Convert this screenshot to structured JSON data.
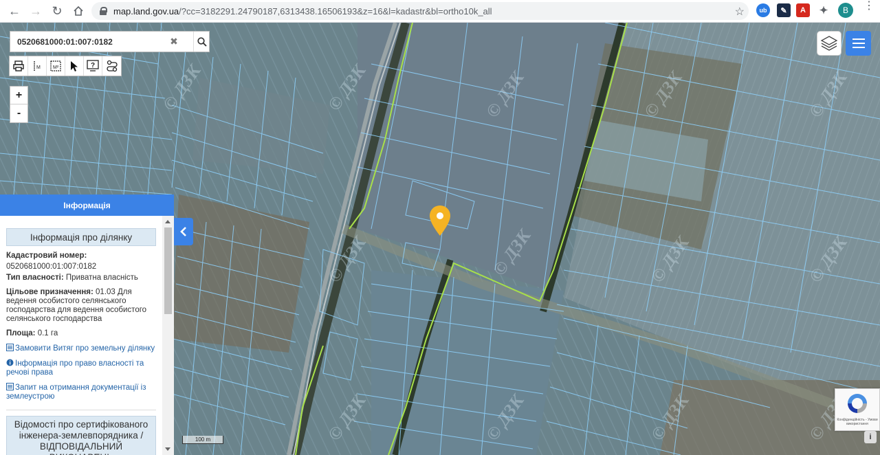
{
  "browser": {
    "url_host": "map.land.gov.ua",
    "url_path": "/?cc=3182291.24790187,6313438.16506193&z=16&l=kadastr&bl=ortho10k_all",
    "profile_initial": "B"
  },
  "search": {
    "value": "0520681000:01:007:0182"
  },
  "zoom": {
    "in_label": "+",
    "out_label": "-"
  },
  "panel": {
    "header": "Інформація",
    "section_title": "Інформація про ділянку",
    "cadastral_label": "Кадастровий номер:",
    "cadastral_value": "0520681000:01:007:0182",
    "ownership_label": "Тип власності:",
    "ownership_value": "Приватна власність",
    "purpose_label": "Цільове призначення:",
    "purpose_value": "01.03  Для ведення особистого селянського господарства  для ведення особистого селянського господарства",
    "area_label": "Площа:",
    "area_value": "0.1 га",
    "links": [
      "Замовити Витяг про земельну ділянку",
      "Інформація про право власності та речові права",
      "Запит на отримання документації із землеустрою"
    ],
    "certified_title": "Відомості про сертифікованого інженера-землевпорядника / ВІДПОВІДАЛЬНИЙ ВИКОНАВЕЦЬ"
  },
  "map": {
    "scale_label": "100 m",
    "watermark": "© ДЗК",
    "recaptcha_text": "Конфіденційність - Умови використання",
    "info_label": "i"
  },
  "colors": {
    "accent": "#3b82e6",
    "parcel_line": "#8fd3ff",
    "boundary_line": "#a8e04a",
    "marker": "#f5b324"
  }
}
